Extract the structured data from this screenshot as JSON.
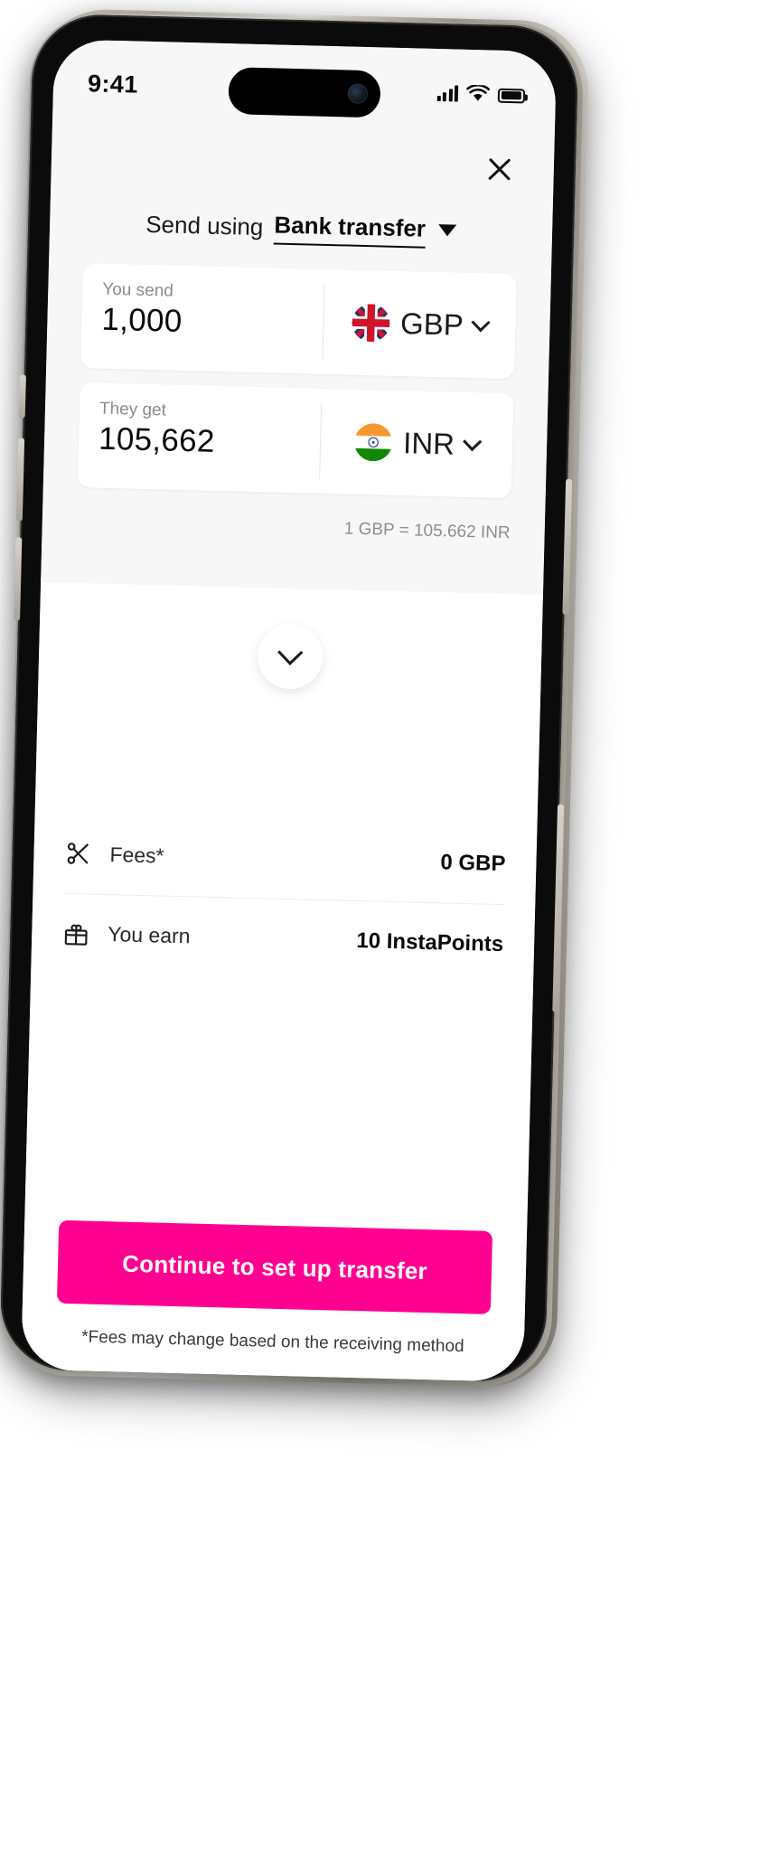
{
  "status_bar": {
    "time": "9:41",
    "signal_icon": "cellular-signal-icon",
    "wifi_icon": "wifi-icon",
    "battery_icon": "battery-full-icon"
  },
  "header": {
    "close_icon": "close-icon",
    "send_using_label": "Send using",
    "send_using_value": "Bank transfer",
    "dropdown_icon": "caret-down-icon"
  },
  "you_send": {
    "label": "You send",
    "amount": "1,000",
    "currency": "GBP",
    "flag": "uk-flag-icon",
    "chevron_icon": "chevron-down-icon"
  },
  "they_get": {
    "label": "They get",
    "amount": "105,662",
    "currency": "INR",
    "flag": "india-flag-icon",
    "chevron_icon": "chevron-down-icon"
  },
  "rate": {
    "text": "1 GBP = 105.662 INR"
  },
  "collapse_handle": {
    "icon": "chevron-down-icon"
  },
  "details": {
    "rows": [
      {
        "icon": "scissors-icon",
        "label": "Fees*",
        "value": "0 GBP"
      },
      {
        "icon": "gift-icon",
        "label": "You earn",
        "value": "10 InstaPoints"
      }
    ]
  },
  "cta": {
    "label": "Continue to set up transfer"
  },
  "footnote": {
    "text": "*Fees may change based on the receiving method"
  },
  "colors": {
    "accent": "#ff0090",
    "panel_bg": "#f7f7f7",
    "card_bg": "#ffffff",
    "text_primary": "#0a0a0a",
    "text_muted": "#8b8b8b"
  }
}
